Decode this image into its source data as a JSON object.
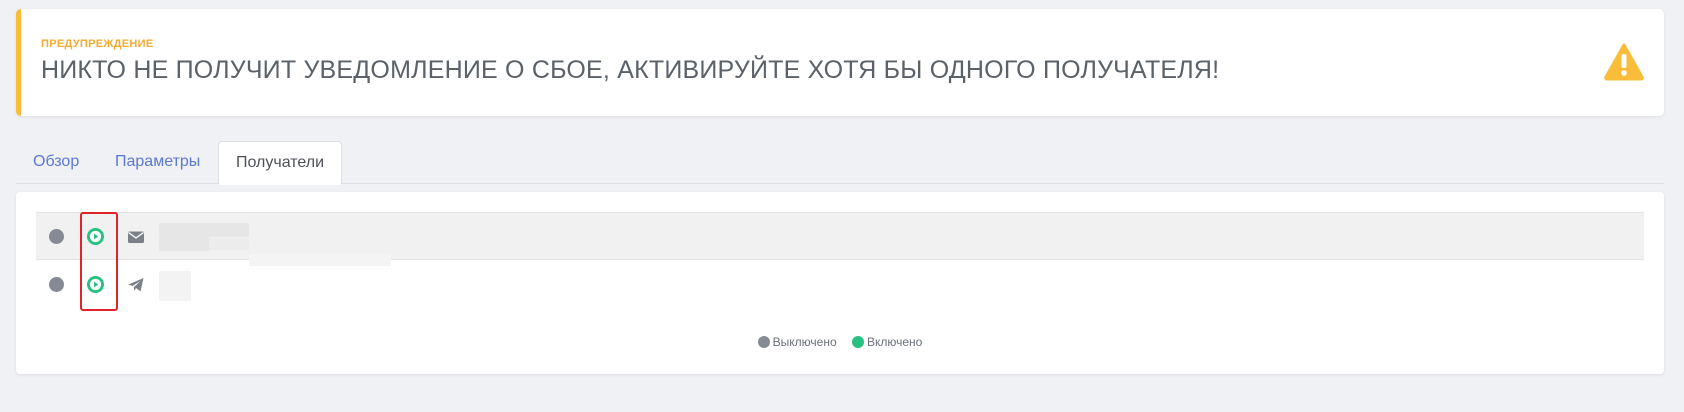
{
  "alert": {
    "label": "ПРЕДУПРЕЖДЕНИЕ",
    "message": "НИКТО НЕ ПОЛУЧИТ УВЕДОМЛЕНИЕ О СБОЕ, АКТИВИРУЙТЕ ХОТЯ БЫ ОДНОГО ПОЛУЧАТЕЛЯ!",
    "icon": "warning-triangle-icon",
    "color": "#f9bd3a"
  },
  "tabs": [
    {
      "label": "Обзор",
      "active": false
    },
    {
      "label": "Параметры",
      "active": false
    },
    {
      "label": "Получатели",
      "active": true
    }
  ],
  "recipients": [
    {
      "channel": "email",
      "icon": "envelope-icon",
      "status": "off",
      "action_icon": "play-icon"
    },
    {
      "channel": "telegram",
      "icon": "paper-plane-icon",
      "status": "off",
      "action_icon": "play-icon"
    }
  ],
  "legend": {
    "off_label": "Выключено",
    "on_label": "Включено",
    "off_color": "#868a94",
    "on_color": "#27c281"
  }
}
